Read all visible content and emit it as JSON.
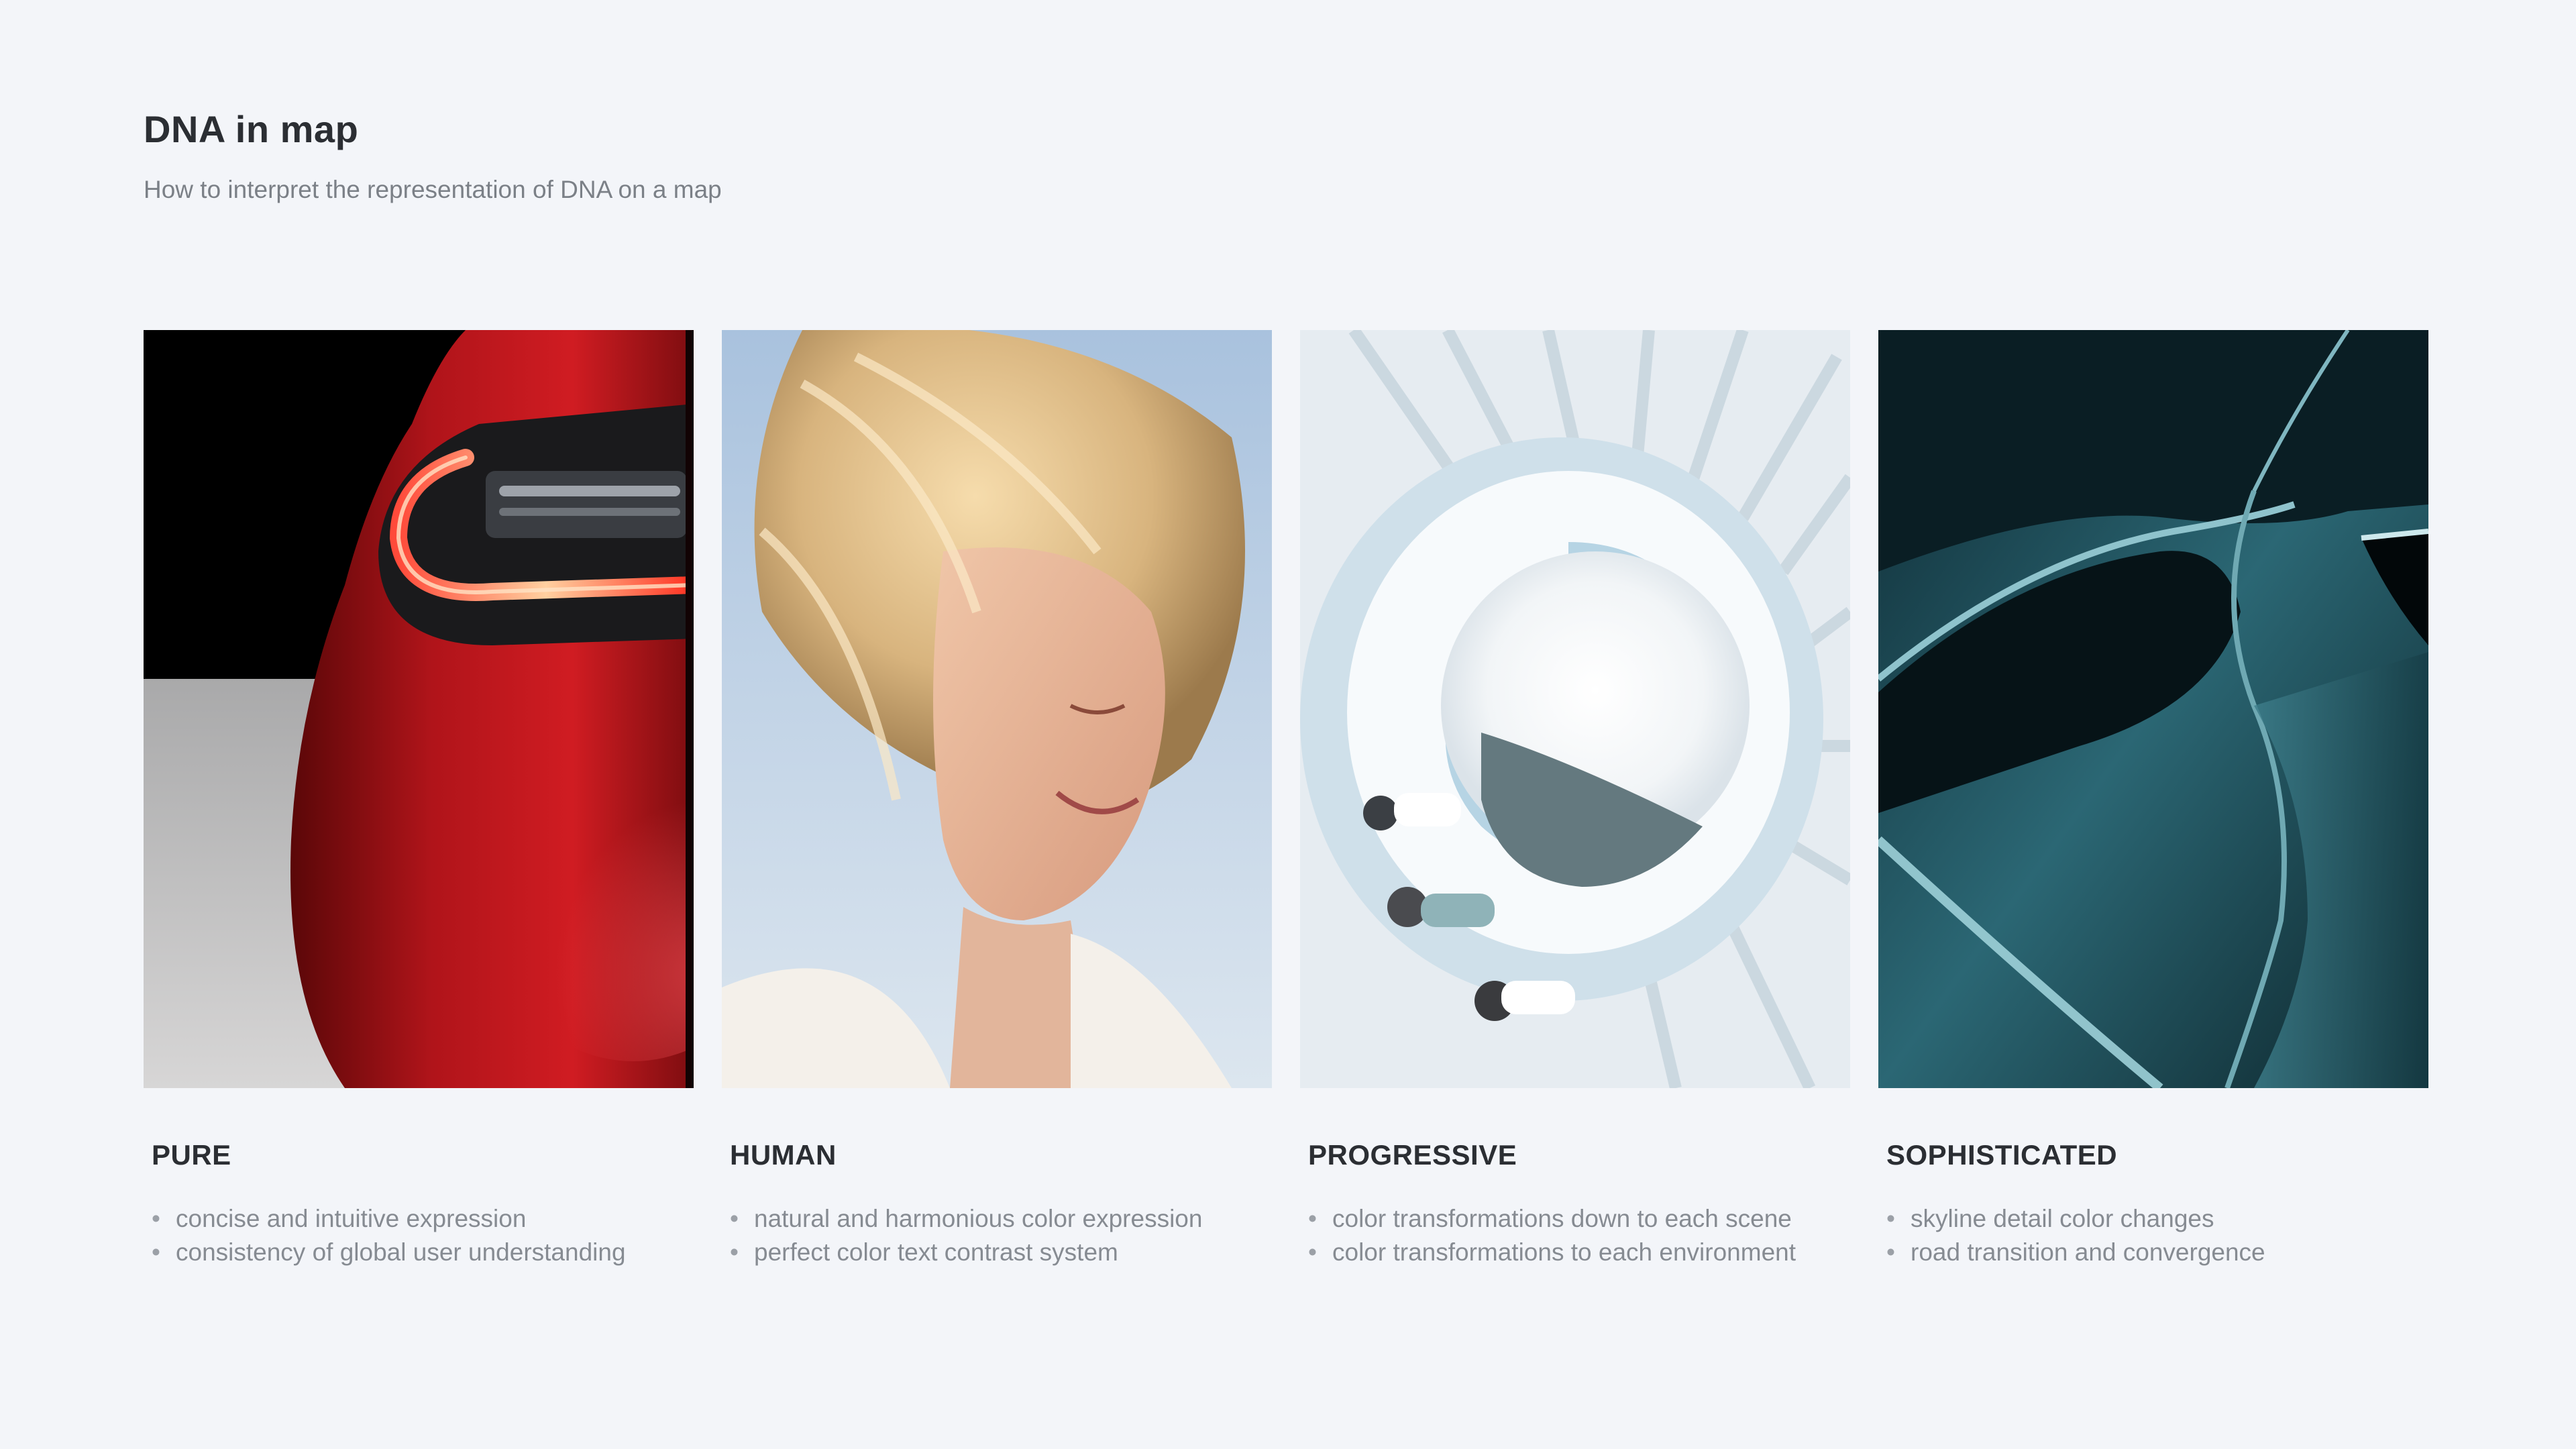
{
  "header": {
    "title": "DNA in map",
    "subtitle": "How to interpret the representation of DNA on a map"
  },
  "cards": [
    {
      "title": "PURE",
      "image": "red-car-taillight-photo",
      "points": [
        "concise and intuitive expression",
        "consistency of global user understanding"
      ]
    },
    {
      "title": "HUMAN",
      "image": "smiling-blonde-woman-photo",
      "points": [
        "natural and harmonious color expression",
        "perfect color text contrast system"
      ]
    },
    {
      "title": "PROGRESSIVE",
      "image": "white-spiral-staircase-photo",
      "points": [
        "color transformations down to each scene",
        "color transformations to each environment"
      ]
    },
    {
      "title": "SOPHISTICATED",
      "image": "teal-car-body-detail-photo",
      "points": [
        "skyline detail color changes",
        "road transition and convergence"
      ]
    }
  ],
  "colors": {
    "background": "#f3f5f9",
    "title": "#2b2e33",
    "body_text": "#868b92"
  }
}
